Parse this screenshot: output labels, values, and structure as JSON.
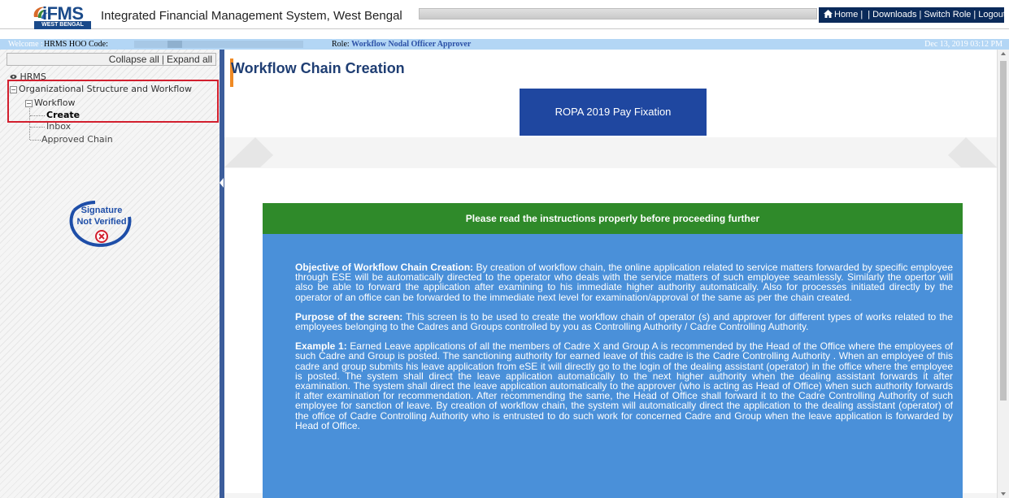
{
  "header": {
    "logo_text": "iFMS",
    "logo_sub": "WEST BENGAL",
    "app_title": "Integrated Financial Management System, West Bengal",
    "nav": {
      "home": "Home",
      "downloads": "Downloads",
      "switch_role": "Switch Role",
      "logout": "Logout"
    }
  },
  "welcome_bar": {
    "welcome_label": "Welcome :",
    "hrms_label": "HRMS HOO Code:",
    "role_label": "Role:",
    "role_value": "Workflow Nodal Officer Approver",
    "datetime": "Dec 13, 2019 03:12 PM"
  },
  "sidebar": {
    "collapse_all": "Collapse all",
    "expand_all": "Expand all",
    "tree": {
      "hrms": "HRMS",
      "org_structure": "Organizational Structure and Workflow",
      "workflow": "Workflow",
      "create": "Create",
      "inbox": "Inbox",
      "approved_chain": "Approved Chain"
    },
    "signature_badge": {
      "line1": "Signature",
      "line2": "Not Verified"
    }
  },
  "main": {
    "page_title": "Workflow Chain Creation",
    "ropa_button": "ROPA 2019 Pay Fixation",
    "instructions_banner": "Please read the instructions properly before proceeding further",
    "paragraphs": [
      {
        "heading": "Objective of Workflow Chain Creation:",
        "text": " By creation of workflow chain, the online application related to service matters forwarded by specific employee through ESE will be automatically directed to the operator who deals with the service matters of such employee seamlessly. Similarly the opertor will also be able to forward the application after examining to his immediate higher authority automatically. Also for processes initiated directly by the operator of an office can be forwarded to the immediate next level for examination/approval of the same as per the chain created."
      },
      {
        "heading": "Purpose of the screen:",
        "text": " This screen is to be used to create the workflow chain of operator (s) and approver for different types of works related to the employees belonging to the Cadres and Groups controlled by you as Controlling Authority / Cadre Controlling Authority."
      },
      {
        "heading": "Example 1:",
        "text": " Earned Leave applications of all the members of Cadre X and Group A is recommended by the Head of the Office where the employees of such Cadre and Group is posted. The sanctioning authority for earned leave of this cadre is the Cadre Controlling Authority . When an employee of this cadre and group submits his leave application from eSE it will directly go to the login of the dealing assistant (operator) in the office where the employee is posted. The system shall direct the leave application automatically to the next higher authority when the dealing assistant forwards it after examination. The system shall direct the leave application automatically to the approver (who is acting as Head of Office) when such authority forwards it after examination for recommendation. After recommending the same, the Head of Office shall forward it to the Cadre Controlling Authority of such employee for sanction of leave. By creation of workflow chain, the system will automatically direct the application to the dealing assistant (operator) of the office of Cadre Controlling Authority who is entrusted to do such work for concerned Cadre and Group when the leave application is forwarded by Head of Office."
      }
    ]
  },
  "colors": {
    "nav_bg": "#0a2a5a",
    "welcome_bg": "#b3d6f5",
    "title_color": "#1f3e73",
    "ropa_bg": "#1f47a0",
    "banner_green": "#2f8a2a",
    "box_blue": "#4a90d9",
    "highlight_red": "#d21f2e",
    "accent_orange": "#f08a24"
  },
  "icons": [
    "logo-swirl-icon",
    "home-icon",
    "eye-icon",
    "tree-minus-icon",
    "signature-x-icon",
    "collapse-arrow-icon"
  ]
}
